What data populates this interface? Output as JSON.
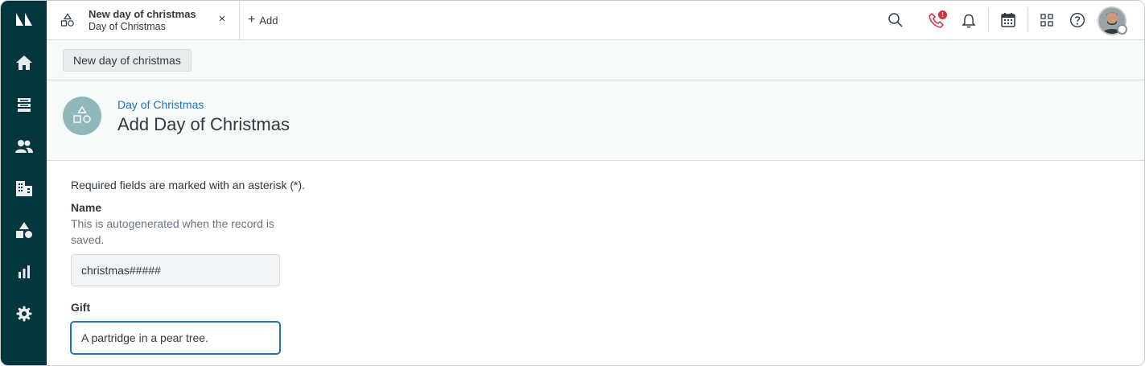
{
  "tab": {
    "title": "New day of christmas",
    "subtitle": "Day of Christmas",
    "close_symbol": "×"
  },
  "add_button": {
    "label": "Add"
  },
  "topbar": {
    "notification_badge": "!"
  },
  "record_button": {
    "label": "New day of christmas"
  },
  "page_header": {
    "breadcrumb": "Day of Christmas",
    "title": "Add Day of Christmas"
  },
  "form": {
    "required_note": "Required fields are marked with an asterisk (*).",
    "name": {
      "label": "Name",
      "hint": "This is autogenerated when the record is saved.",
      "value": "christmas#####"
    },
    "gift": {
      "label": "Gift",
      "value": "A partridge in a pear tree."
    }
  },
  "nav": {
    "items": [
      "zendesk-logo-icon",
      "home-icon",
      "views-icon",
      "customers-icon",
      "organizations-icon",
      "objects-icon",
      "reporting-icon",
      "admin-gear-icon"
    ]
  },
  "colors": {
    "nav_bg": "#03363d",
    "accent": "#1f73b7",
    "object_avatar": "#8eb8ba",
    "badge": "#cc3340"
  }
}
